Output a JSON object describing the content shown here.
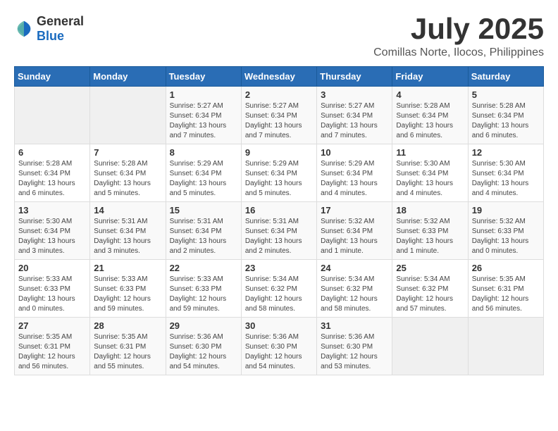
{
  "logo": {
    "general": "General",
    "blue": "Blue"
  },
  "title": "July 2025",
  "subtitle": "Comillas Norte, Ilocos, Philippines",
  "days_of_week": [
    "Sunday",
    "Monday",
    "Tuesday",
    "Wednesday",
    "Thursday",
    "Friday",
    "Saturday"
  ],
  "weeks": [
    [
      {
        "day": "",
        "detail": ""
      },
      {
        "day": "",
        "detail": ""
      },
      {
        "day": "1",
        "detail": "Sunrise: 5:27 AM\nSunset: 6:34 PM\nDaylight: 13 hours and 7 minutes."
      },
      {
        "day": "2",
        "detail": "Sunrise: 5:27 AM\nSunset: 6:34 PM\nDaylight: 13 hours and 7 minutes."
      },
      {
        "day": "3",
        "detail": "Sunrise: 5:27 AM\nSunset: 6:34 PM\nDaylight: 13 hours and 7 minutes."
      },
      {
        "day": "4",
        "detail": "Sunrise: 5:28 AM\nSunset: 6:34 PM\nDaylight: 13 hours and 6 minutes."
      },
      {
        "day": "5",
        "detail": "Sunrise: 5:28 AM\nSunset: 6:34 PM\nDaylight: 13 hours and 6 minutes."
      }
    ],
    [
      {
        "day": "6",
        "detail": "Sunrise: 5:28 AM\nSunset: 6:34 PM\nDaylight: 13 hours and 6 minutes."
      },
      {
        "day": "7",
        "detail": "Sunrise: 5:28 AM\nSunset: 6:34 PM\nDaylight: 13 hours and 5 minutes."
      },
      {
        "day": "8",
        "detail": "Sunrise: 5:29 AM\nSunset: 6:34 PM\nDaylight: 13 hours and 5 minutes."
      },
      {
        "day": "9",
        "detail": "Sunrise: 5:29 AM\nSunset: 6:34 PM\nDaylight: 13 hours and 5 minutes."
      },
      {
        "day": "10",
        "detail": "Sunrise: 5:29 AM\nSunset: 6:34 PM\nDaylight: 13 hours and 4 minutes."
      },
      {
        "day": "11",
        "detail": "Sunrise: 5:30 AM\nSunset: 6:34 PM\nDaylight: 13 hours and 4 minutes."
      },
      {
        "day": "12",
        "detail": "Sunrise: 5:30 AM\nSunset: 6:34 PM\nDaylight: 13 hours and 4 minutes."
      }
    ],
    [
      {
        "day": "13",
        "detail": "Sunrise: 5:30 AM\nSunset: 6:34 PM\nDaylight: 13 hours and 3 minutes."
      },
      {
        "day": "14",
        "detail": "Sunrise: 5:31 AM\nSunset: 6:34 PM\nDaylight: 13 hours and 3 minutes."
      },
      {
        "day": "15",
        "detail": "Sunrise: 5:31 AM\nSunset: 6:34 PM\nDaylight: 13 hours and 2 minutes."
      },
      {
        "day": "16",
        "detail": "Sunrise: 5:31 AM\nSunset: 6:34 PM\nDaylight: 13 hours and 2 minutes."
      },
      {
        "day": "17",
        "detail": "Sunrise: 5:32 AM\nSunset: 6:34 PM\nDaylight: 13 hours and 1 minute."
      },
      {
        "day": "18",
        "detail": "Sunrise: 5:32 AM\nSunset: 6:33 PM\nDaylight: 13 hours and 1 minute."
      },
      {
        "day": "19",
        "detail": "Sunrise: 5:32 AM\nSunset: 6:33 PM\nDaylight: 13 hours and 0 minutes."
      }
    ],
    [
      {
        "day": "20",
        "detail": "Sunrise: 5:33 AM\nSunset: 6:33 PM\nDaylight: 13 hours and 0 minutes."
      },
      {
        "day": "21",
        "detail": "Sunrise: 5:33 AM\nSunset: 6:33 PM\nDaylight: 12 hours and 59 minutes."
      },
      {
        "day": "22",
        "detail": "Sunrise: 5:33 AM\nSunset: 6:33 PM\nDaylight: 12 hours and 59 minutes."
      },
      {
        "day": "23",
        "detail": "Sunrise: 5:34 AM\nSunset: 6:32 PM\nDaylight: 12 hours and 58 minutes."
      },
      {
        "day": "24",
        "detail": "Sunrise: 5:34 AM\nSunset: 6:32 PM\nDaylight: 12 hours and 58 minutes."
      },
      {
        "day": "25",
        "detail": "Sunrise: 5:34 AM\nSunset: 6:32 PM\nDaylight: 12 hours and 57 minutes."
      },
      {
        "day": "26",
        "detail": "Sunrise: 5:35 AM\nSunset: 6:31 PM\nDaylight: 12 hours and 56 minutes."
      }
    ],
    [
      {
        "day": "27",
        "detail": "Sunrise: 5:35 AM\nSunset: 6:31 PM\nDaylight: 12 hours and 56 minutes."
      },
      {
        "day": "28",
        "detail": "Sunrise: 5:35 AM\nSunset: 6:31 PM\nDaylight: 12 hours and 55 minutes."
      },
      {
        "day": "29",
        "detail": "Sunrise: 5:36 AM\nSunset: 6:30 PM\nDaylight: 12 hours and 54 minutes."
      },
      {
        "day": "30",
        "detail": "Sunrise: 5:36 AM\nSunset: 6:30 PM\nDaylight: 12 hours and 54 minutes."
      },
      {
        "day": "31",
        "detail": "Sunrise: 5:36 AM\nSunset: 6:30 PM\nDaylight: 12 hours and 53 minutes."
      },
      {
        "day": "",
        "detail": ""
      },
      {
        "day": "",
        "detail": ""
      }
    ]
  ]
}
